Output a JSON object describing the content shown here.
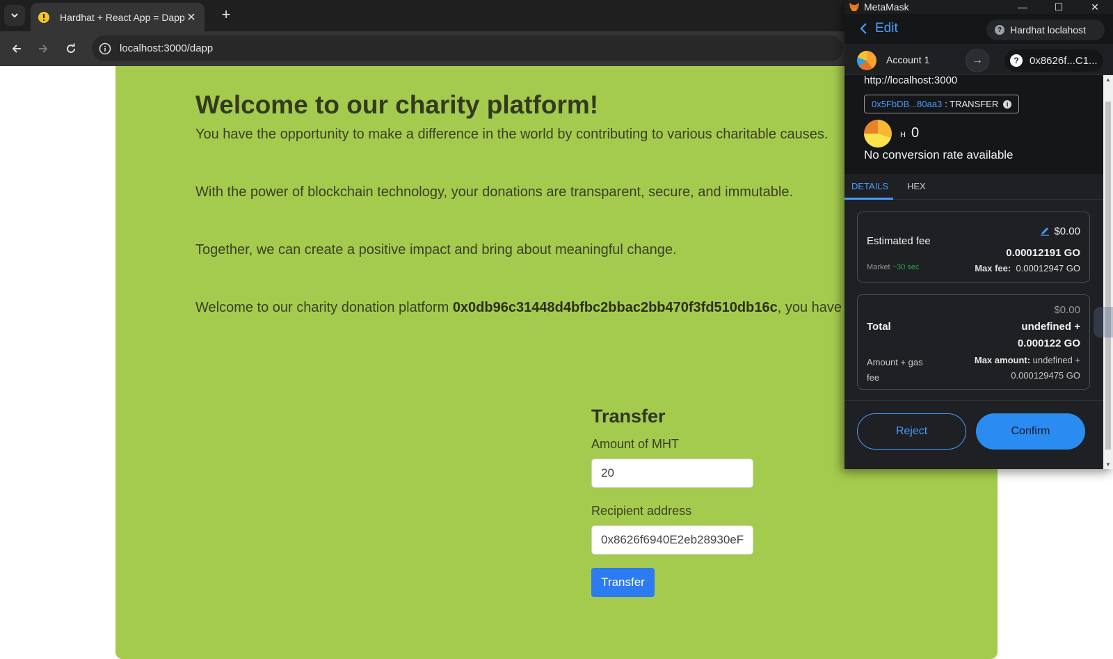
{
  "browser": {
    "tab_title": "Hardhat + React App = Dapp",
    "url": "localhost:3000/dapp"
  },
  "page": {
    "headline": "Welcome to our charity platform!",
    "paragraphs": [
      "You have the opportunity to make a difference in the world by contributing to various charitable causes.",
      "With the power of blockchain technology, your donations are transparent, secure, and immutable.",
      "Together, we can create a positive impact and bring about meaningful change."
    ],
    "welcome_prefix": "Welcome to our charity donation platform ",
    "welcome_address": "0x0db96c31448d4bfbc2bbac2bb470f3fd510db16c",
    "welcome_suffix": ", you have",
    "transfer": {
      "title": "Transfer",
      "amount_label": "Amount of MHT",
      "amount_value": "20",
      "recipient_label": "Recipient address",
      "recipient_value": "0x8626f6940E2eb28930eF",
      "button_label": "Transfer"
    }
  },
  "metamask": {
    "app_title": "MetaMask",
    "back_label": "Edit",
    "network": "Hardhat loclahost",
    "account_name": "Account 1",
    "destination": "0x8626f...C1...",
    "origin": "http://localhost:3000",
    "contract_address": "0x5FbDB...80aa3",
    "method": ": TRANSFER",
    "token_symbol": "H",
    "token_amount": "0",
    "conversion": "No conversion rate available",
    "tabs": [
      "DETAILS",
      "HEX"
    ],
    "fee": {
      "label": "Estimated fee",
      "fiat": "$0.00",
      "amount": "0.00012191 GO",
      "market_label": "Market",
      "market_time": "~30 sec",
      "max_fee_label": "Max fee:",
      "max_fee_value": "0.00012947 GO"
    },
    "total": {
      "label": "Total",
      "fiat": "$0.00",
      "amount_line1": "undefined +",
      "amount_line2": "0.000122 GO",
      "sub_label_line1": "Amount + gas",
      "sub_label_line2": "fee",
      "max_amount_label": "Max amount:",
      "max_amount_line1": "undefined +",
      "max_amount_line2": "0.000129475 GO"
    },
    "reject_label": "Reject",
    "confirm_label": "Confirm"
  }
}
